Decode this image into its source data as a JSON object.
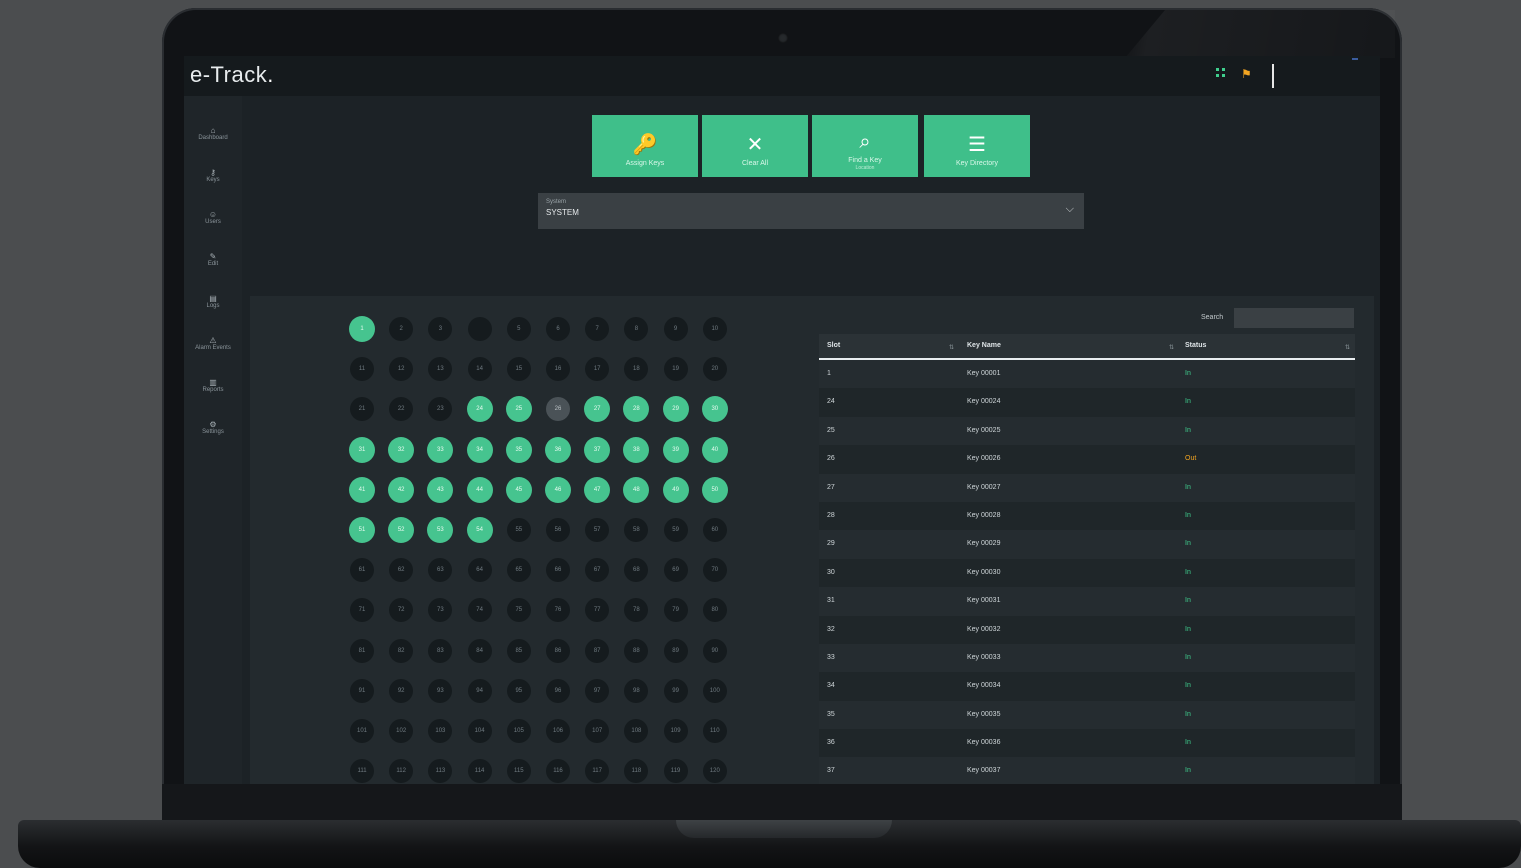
{
  "app": {
    "title": "e-Track",
    "title_dot": ".",
    "flag_icon": "flag-icon",
    "grid_icon": "grid-icon"
  },
  "colors": {
    "accent": "#3fbf8a",
    "slot_on": "#46c48f",
    "warn": "#f3a521",
    "background": "#1c2226"
  },
  "sidebar": {
    "items": [
      {
        "icon": "home-icon",
        "label": "Dashboard"
      },
      {
        "icon": "key-icon",
        "label": "Keys"
      },
      {
        "icon": "users-icon",
        "label": "Users"
      },
      {
        "icon": "pen-icon",
        "label": "Edit"
      },
      {
        "icon": "doc-icon",
        "label": "Logs"
      },
      {
        "icon": "alert-icon",
        "label": "Alarm Events"
      },
      {
        "icon": "chart-icon",
        "label": "Reports"
      },
      {
        "icon": "gear-icon",
        "label": "Settings"
      }
    ]
  },
  "actions": [
    {
      "icon": "key-icon",
      "glyph": "🔑",
      "label": "Assign Keys",
      "sub": ""
    },
    {
      "icon": "close-icon",
      "glyph": "✕",
      "label": "Clear All",
      "sub": ""
    },
    {
      "icon": "search-icon",
      "glyph": "⌕",
      "label": "Find a Key",
      "sub": "Location"
    },
    {
      "icon": "menu-icon",
      "glyph": "☰",
      "label": "Key Directory",
      "sub": ""
    }
  ],
  "system_select": {
    "label": "System",
    "value": "SYSTEM",
    "chevron": "⌵"
  },
  "grid": {
    "rows": [
      [
        "1",
        "2",
        "3",
        "",
        "5",
        "6",
        "7",
        "8",
        "9",
        "10"
      ],
      [
        "11",
        "12",
        "13",
        "14",
        "15",
        "16",
        "17",
        "18",
        "19",
        "20"
      ],
      [
        "21",
        "22",
        "23",
        "24",
        "25",
        "26",
        "27",
        "28",
        "29",
        "30"
      ],
      [
        "31",
        "32",
        "33",
        "34",
        "35",
        "36",
        "37",
        "38",
        "39",
        "40"
      ],
      [
        "41",
        "42",
        "43",
        "44",
        "45",
        "46",
        "47",
        "48",
        "49",
        "50"
      ],
      [
        "51",
        "52",
        "53",
        "54",
        "55",
        "56",
        "57",
        "58",
        "59",
        "60"
      ],
      [
        "61",
        "62",
        "63",
        "64",
        "65",
        "66",
        "67",
        "68",
        "69",
        "70"
      ],
      [
        "71",
        "72",
        "73",
        "74",
        "75",
        "76",
        "77",
        "78",
        "79",
        "80"
      ],
      [
        "81",
        "82",
        "83",
        "84",
        "85",
        "86",
        "87",
        "88",
        "89",
        "90"
      ],
      [
        "91",
        "92",
        "93",
        "94",
        "95",
        "96",
        "97",
        "98",
        "99",
        "100"
      ],
      [
        "101",
        "102",
        "103",
        "104",
        "105",
        "106",
        "107",
        "108",
        "109",
        "110"
      ],
      [
        "111",
        "112",
        "113",
        "114",
        "115",
        "116",
        "117",
        "118",
        "119",
        "120"
      ]
    ],
    "states": [
      [
        "on",
        "off",
        "off",
        "off",
        "off",
        "off",
        "off",
        "off",
        "off",
        "off"
      ],
      [
        "off",
        "off",
        "off",
        "off",
        "off",
        "off",
        "off",
        "off",
        "off",
        "off"
      ],
      [
        "off",
        "off",
        "off",
        "on",
        "on",
        "sel",
        "on",
        "on",
        "on",
        "on"
      ],
      [
        "on",
        "on",
        "on",
        "on",
        "on",
        "on",
        "on",
        "on",
        "on",
        "on"
      ],
      [
        "on",
        "on",
        "on",
        "on",
        "on",
        "on",
        "on",
        "on",
        "on",
        "on"
      ],
      [
        "on",
        "on",
        "on",
        "on",
        "off",
        "off",
        "off",
        "off",
        "off",
        "off"
      ],
      [
        "off",
        "off",
        "off",
        "off",
        "off",
        "off",
        "off",
        "off",
        "off",
        "off"
      ],
      [
        "off",
        "off",
        "off",
        "off",
        "off",
        "off",
        "off",
        "off",
        "off",
        "off"
      ],
      [
        "off",
        "off",
        "off",
        "off",
        "off",
        "off",
        "off",
        "off",
        "off",
        "off"
      ],
      [
        "off",
        "off",
        "off",
        "off",
        "off",
        "off",
        "off",
        "off",
        "off",
        "off"
      ],
      [
        "off",
        "off",
        "off",
        "off",
        "off",
        "off",
        "off",
        "off",
        "off",
        "off"
      ],
      [
        "off",
        "off",
        "off",
        "off",
        "off",
        "off",
        "off",
        "off",
        "off",
        "off"
      ]
    ]
  },
  "search": {
    "label": "Search",
    "placeholder": ""
  },
  "table": {
    "columns": [
      "Slot",
      "Key Name",
      "Status"
    ],
    "rows": [
      {
        "slot": "1",
        "name": "Key 00001",
        "status": "In",
        "warn": false
      },
      {
        "slot": "24",
        "name": "Key 00024",
        "status": "In",
        "warn": false
      },
      {
        "slot": "25",
        "name": "Key 00025",
        "status": "In",
        "warn": false
      },
      {
        "slot": "26",
        "name": "Key 00026",
        "status": "Out",
        "warn": true
      },
      {
        "slot": "27",
        "name": "Key 00027",
        "status": "In",
        "warn": false
      },
      {
        "slot": "28",
        "name": "Key 00028",
        "status": "In",
        "warn": false
      },
      {
        "slot": "29",
        "name": "Key 00029",
        "status": "In",
        "warn": false
      },
      {
        "slot": "30",
        "name": "Key 00030",
        "status": "In",
        "warn": false
      },
      {
        "slot": "31",
        "name": "Key 00031",
        "status": "In",
        "warn": false
      },
      {
        "slot": "32",
        "name": "Key 00032",
        "status": "In",
        "warn": false
      },
      {
        "slot": "33",
        "name": "Key 00033",
        "status": "In",
        "warn": false
      },
      {
        "slot": "34",
        "name": "Key 00034",
        "status": "In",
        "warn": false
      },
      {
        "slot": "35",
        "name": "Key 00035",
        "status": "In",
        "warn": false
      },
      {
        "slot": "36",
        "name": "Key 00036",
        "status": "In",
        "warn": false
      },
      {
        "slot": "37",
        "name": "Key 00037",
        "status": "In",
        "warn": false
      }
    ]
  }
}
